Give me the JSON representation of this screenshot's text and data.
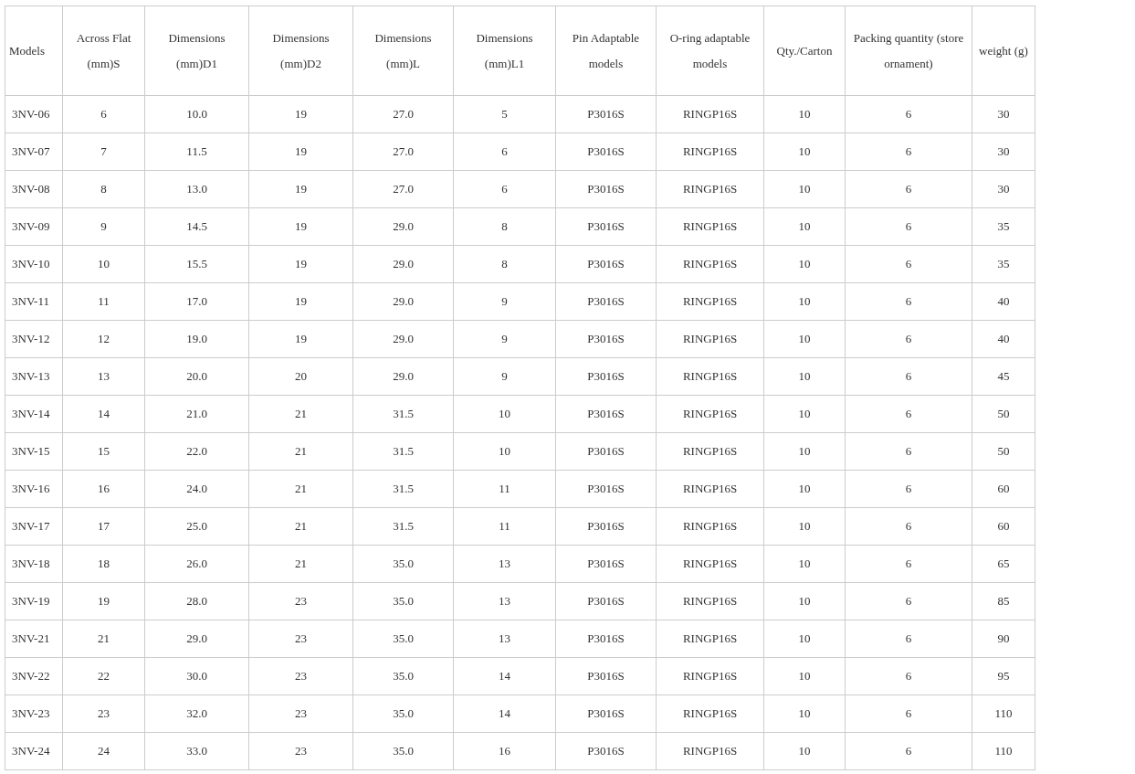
{
  "table": {
    "columns": [
      "Models",
      "Across Flat (mm)S",
      "Dimensions (mm)D1",
      "Dimensions (mm)D2",
      "Dimensions (mm)L",
      "Dimensions (mm)L1",
      "Pin Adaptable models",
      "O-ring adaptable models",
      "Qty./Carton",
      "Packing quantity (store ornament)",
      "weight (g)"
    ],
    "rows": [
      [
        "3NV-06",
        "6",
        "10.0",
        "19",
        "27.0",
        "5",
        "P3016S",
        "RINGP16S",
        "10",
        "6",
        "30"
      ],
      [
        "3NV-07",
        "7",
        "11.5",
        "19",
        "27.0",
        "6",
        "P3016S",
        "RINGP16S",
        "10",
        "6",
        "30"
      ],
      [
        "3NV-08",
        "8",
        "13.0",
        "19",
        "27.0",
        "6",
        "P3016S",
        "RINGP16S",
        "10",
        "6",
        "30"
      ],
      [
        "3NV-09",
        "9",
        "14.5",
        "19",
        "29.0",
        "8",
        "P3016S",
        "RINGP16S",
        "10",
        "6",
        "35"
      ],
      [
        "3NV-10",
        "10",
        "15.5",
        "19",
        "29.0",
        "8",
        "P3016S",
        "RINGP16S",
        "10",
        "6",
        "35"
      ],
      [
        "3NV-11",
        "11",
        "17.0",
        "19",
        "29.0",
        "9",
        "P3016S",
        "RINGP16S",
        "10",
        "6",
        "40"
      ],
      [
        "3NV-12",
        "12",
        "19.0",
        "19",
        "29.0",
        "9",
        "P3016S",
        "RINGP16S",
        "10",
        "6",
        "40"
      ],
      [
        "3NV-13",
        "13",
        "20.0",
        "20",
        "29.0",
        "9",
        "P3016S",
        "RINGP16S",
        "10",
        "6",
        "45"
      ],
      [
        "3NV-14",
        "14",
        "21.0",
        "21",
        "31.5",
        "10",
        "P3016S",
        "RINGP16S",
        "10",
        "6",
        "50"
      ],
      [
        "3NV-15",
        "15",
        "22.0",
        "21",
        "31.5",
        "10",
        "P3016S",
        "RINGP16S",
        "10",
        "6",
        "50"
      ],
      [
        "3NV-16",
        "16",
        "24.0",
        "21",
        "31.5",
        "11",
        "P3016S",
        "RINGP16S",
        "10",
        "6",
        "60"
      ],
      [
        "3NV-17",
        "17",
        "25.0",
        "21",
        "31.5",
        "11",
        "P3016S",
        "RINGP16S",
        "10",
        "6",
        "60"
      ],
      [
        "3NV-18",
        "18",
        "26.0",
        "21",
        "35.0",
        "13",
        "P3016S",
        "RINGP16S",
        "10",
        "6",
        "65"
      ],
      [
        "3NV-19",
        "19",
        "28.0",
        "23",
        "35.0",
        "13",
        "P3016S",
        "RINGP16S",
        "10",
        "6",
        "85"
      ],
      [
        "3NV-21",
        "21",
        "29.0",
        "23",
        "35.0",
        "13",
        "P3016S",
        "RINGP16S",
        "10",
        "6",
        "90"
      ],
      [
        "3NV-22",
        "22",
        "30.0",
        "23",
        "35.0",
        "14",
        "P3016S",
        "RINGP16S",
        "10",
        "6",
        "95"
      ],
      [
        "3NV-23",
        "23",
        "32.0",
        "23",
        "35.0",
        "14",
        "P3016S",
        "RINGP16S",
        "10",
        "6",
        "110"
      ],
      [
        "3NV-24",
        "24",
        "33.0",
        "23",
        "35.0",
        "16",
        "P3016S",
        "RINGP16S",
        "10",
        "6",
        "110"
      ]
    ]
  }
}
